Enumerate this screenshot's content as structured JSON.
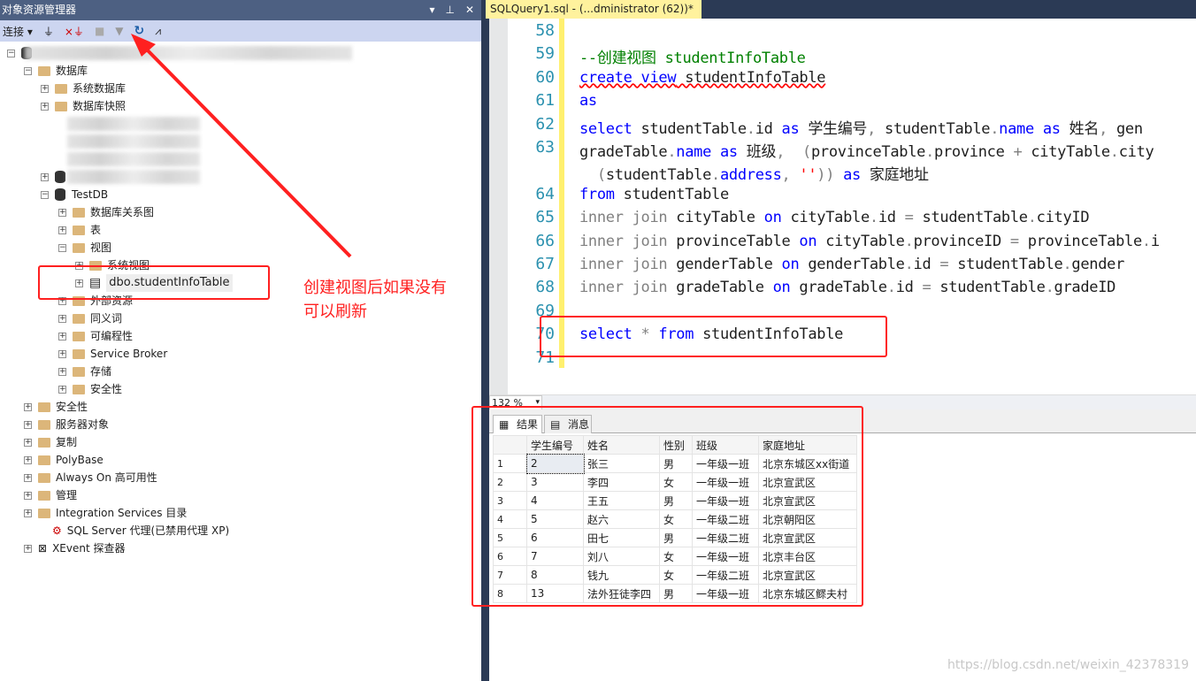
{
  "explorer": {
    "title": "对象资源管理器",
    "connect_label": "连接",
    "tree": [
      {
        "label": "",
        "level": 0,
        "exp": "−",
        "icon": "server",
        "blur": true
      },
      {
        "label": "数据库",
        "level": 1,
        "exp": "−",
        "icon": "folder"
      },
      {
        "label": "系统数据库",
        "level": 2,
        "exp": "+",
        "icon": "folder"
      },
      {
        "label": "数据库快照",
        "level": 2,
        "exp": "+",
        "icon": "folder"
      },
      {
        "label": "",
        "level": 2,
        "exp": "",
        "icon": "",
        "blur": true
      },
      {
        "label": "",
        "level": 2,
        "exp": "",
        "icon": "",
        "blur": true
      },
      {
        "label": "",
        "level": 2,
        "exp": "",
        "icon": "",
        "blur": true
      },
      {
        "label": "",
        "level": 2,
        "exp": "+",
        "icon": "db",
        "blur": true
      },
      {
        "label": "TestDB",
        "level": 2,
        "exp": "−",
        "icon": "db"
      },
      {
        "label": "数据库关系图",
        "level": 3,
        "exp": "+",
        "icon": "folder"
      },
      {
        "label": "表",
        "level": 3,
        "exp": "+",
        "icon": "folder"
      },
      {
        "label": "视图",
        "level": 3,
        "exp": "−",
        "icon": "folder"
      },
      {
        "label": "系统视图",
        "level": 4,
        "exp": "+",
        "icon": "folder"
      },
      {
        "label": "dbo.studentInfoTable",
        "level": 4,
        "exp": "+",
        "icon": "view",
        "selected": true
      },
      {
        "label": "外部资源",
        "level": 3,
        "exp": "+",
        "icon": "folder"
      },
      {
        "label": "同义词",
        "level": 3,
        "exp": "+",
        "icon": "folder"
      },
      {
        "label": "可编程性",
        "level": 3,
        "exp": "+",
        "icon": "folder"
      },
      {
        "label": "Service Broker",
        "level": 3,
        "exp": "+",
        "icon": "folder"
      },
      {
        "label": "存储",
        "level": 3,
        "exp": "+",
        "icon": "folder"
      },
      {
        "label": "安全性",
        "level": 3,
        "exp": "+",
        "icon": "folder"
      },
      {
        "label": "安全性",
        "level": 1,
        "exp": "+",
        "icon": "folder"
      },
      {
        "label": "服务器对象",
        "level": 1,
        "exp": "+",
        "icon": "folder"
      },
      {
        "label": "复制",
        "level": 1,
        "exp": "+",
        "icon": "folder"
      },
      {
        "label": "PolyBase",
        "level": 1,
        "exp": "+",
        "icon": "folder"
      },
      {
        "label": "Always On 高可用性",
        "level": 1,
        "exp": "+",
        "icon": "folder"
      },
      {
        "label": "管理",
        "level": 1,
        "exp": "+",
        "icon": "folder"
      },
      {
        "label": "Integration Services 目录",
        "level": 1,
        "exp": "+",
        "icon": "folder"
      },
      {
        "label": "SQL Server 代理(已禁用代理 XP)",
        "level": 1,
        "exp": "",
        "icon": "agent"
      },
      {
        "label": "XEvent 探查器",
        "level": 1,
        "exp": "+",
        "icon": "xevent"
      }
    ]
  },
  "editor": {
    "tab_title": "SQLQuery1.sql - (...dministrator (62))*",
    "zoom": "132 %",
    "lines": [
      {
        "n": "58",
        "html": ""
      },
      {
        "n": "59",
        "html": "<span class='cm'>--创建视图 studentInfoTable</span>"
      },
      {
        "n": "60",
        "html": "<span class='kw'>create view</span> studentInfoTable"
      },
      {
        "n": "61",
        "html": "<span class='kw'>as</span>"
      },
      {
        "n": "62",
        "html": "<span class='kw'>select</span> studentTable<span class='gr'>.</span>id <span class='kw'>as</span> 学生编号<span class='gr'>,</span> studentTable<span class='gr'>.</span><span class='kw'>name</span> <span class='kw'>as</span> 姓名<span class='gr'>,</span> gen"
      },
      {
        "n": "63",
        "html": "gradeTable<span class='gr'>.</span><span class='kw'>name</span> <span class='kw'>as</span> 班级<span class='gr'>,</span>  <span class='gr'>(</span>provinceTable<span class='gr'>.</span>province <span class='gr'>+</span> cityTable<span class='gr'>.</span>city"
      },
      {
        "n": "",
        "html": "  <span class='gr'>(</span>studentTable<span class='gr'>.</span><span class='kw'>address</span><span class='gr'>,</span> <span class='st'>''</span><span class='gr'>))</span> <span class='kw'>as</span> 家庭地址"
      },
      {
        "n": "64",
        "html": "<span class='kw'>from</span> studentTable"
      },
      {
        "n": "65",
        "html": "<span class='gr'>inner join</span> cityTable <span class='kw'>on</span> cityTable<span class='gr'>.</span>id <span class='gr'>=</span> studentTable<span class='gr'>.</span>cityID"
      },
      {
        "n": "66",
        "html": "<span class='gr'>inner join</span> provinceTable <span class='kw'>on</span> cityTable<span class='gr'>.</span>provinceID <span class='gr'>=</span> provinceTable<span class='gr'>.</span>i"
      },
      {
        "n": "67",
        "html": "<span class='gr'>inner join</span> genderTable <span class='kw'>on</span> genderTable<span class='gr'>.</span>id <span class='gr'>=</span> studentTable<span class='gr'>.</span>gender"
      },
      {
        "n": "68",
        "html": "<span class='gr'>inner join</span> gradeTable <span class='kw'>on</span> gradeTable<span class='gr'>.</span>id <span class='gr'>=</span> studentTable<span class='gr'>.</span>gradeID"
      },
      {
        "n": "69",
        "html": ""
      },
      {
        "n": "70",
        "html": "<span class='kw'>select</span> <span class='gr'>*</span> <span class='kw'>from</span> studentInfoTable"
      },
      {
        "n": "71",
        "html": ""
      }
    ]
  },
  "results": {
    "tab_results": "结果",
    "tab_messages": "消息",
    "columns": [
      "",
      "学生编号",
      "姓名",
      "性别",
      "班级",
      "家庭地址"
    ],
    "rows": [
      [
        "1",
        "2",
        "张三",
        "男",
        "一年级一班",
        "北京东城区xx街道"
      ],
      [
        "2",
        "3",
        "李四",
        "女",
        "一年级一班",
        "北京宣武区"
      ],
      [
        "3",
        "4",
        "王五",
        "男",
        "一年级一班",
        "北京宣武区"
      ],
      [
        "4",
        "5",
        "赵六",
        "女",
        "一年级二班",
        "北京朝阳区"
      ],
      [
        "5",
        "6",
        "田七",
        "男",
        "一年级二班",
        "北京宣武区"
      ],
      [
        "6",
        "7",
        "刘八",
        "女",
        "一年级一班",
        "北京丰台区"
      ],
      [
        "7",
        "8",
        "钱九",
        "女",
        "一年级二班",
        "北京宣武区"
      ],
      [
        "8",
        "13",
        "法外狂徒李四",
        "男",
        "一年级一班",
        "北京东城区鳏夫村"
      ]
    ]
  },
  "annotation": {
    "line1": "创建视图后如果没有",
    "line2": "可以刷新",
    "color": "#ff2020"
  },
  "watermark": "https://blog.csdn.net/weixin_42378319"
}
